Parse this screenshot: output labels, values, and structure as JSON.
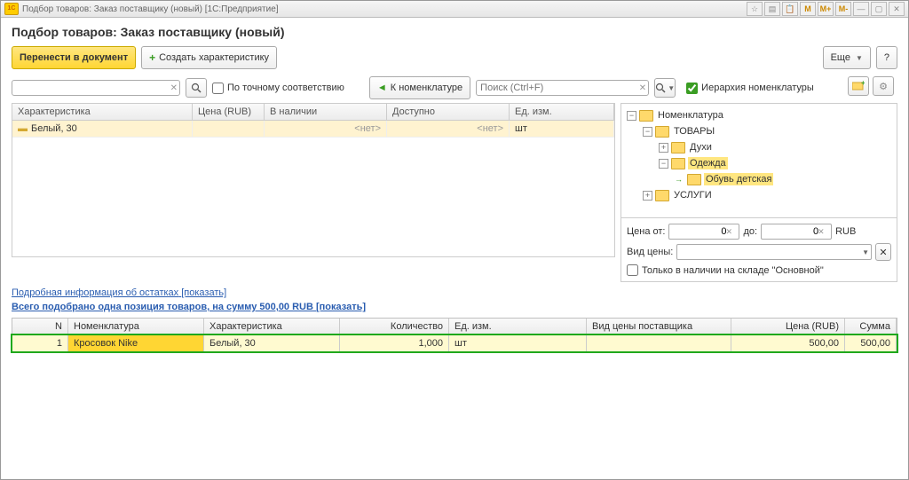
{
  "titlebar": {
    "text": "Подбор товаров: Заказ поставщику (новый)  [1С:Предприятие]",
    "buttons": {
      "m": "M",
      "mplus": "M+",
      "mminus": "M-"
    }
  },
  "header": {
    "title": "Подбор товаров: Заказ поставщику (новый)"
  },
  "toolbar": {
    "transfer": "Перенести в документ",
    "create_char": "Создать характеристику",
    "more": "Еще",
    "help": "?"
  },
  "filter": {
    "exact_match": "По точному соответствию",
    "to_nomenclature": "К номенклатуре",
    "search_placeholder": "Поиск (Ctrl+F)",
    "hierarchy": "Иерархия номенклатуры"
  },
  "chars_table": {
    "headers": {
      "char": "Характеристика",
      "price": "Цена (RUB)",
      "stock": "В наличии",
      "avail": "Доступно",
      "uom": "Ед. изм."
    },
    "rows": [
      {
        "char": "Белый, 30",
        "price": "",
        "stock": "<нет>",
        "avail": "<нет>",
        "uom": "шт"
      }
    ]
  },
  "tree": {
    "root": "Номенклатура",
    "lvl1": "ТОВАРЫ",
    "lvl2a": "Духи",
    "lvl2b": "Одежда",
    "lvl3": "Обувь детская",
    "lvl1b": "УСЛУГИ"
  },
  "price_filter": {
    "from": "Цена от:",
    "to": "до:",
    "currency": "RUB",
    "from_val": "0",
    "to_val": "0",
    "price_type": "Вид цены:",
    "only_stock": "Только в наличии на складе \"Основной\""
  },
  "links": {
    "details": "Подробная информация об остатках",
    "show": "[показать]",
    "summary_prefix": "Всего подобрано одна позиция товаров, на сумму 500,00 RUB",
    "summary_link": "[показать]"
  },
  "bottom_table": {
    "headers": {
      "n": "N",
      "nom": "Номенклатура",
      "char": "Характеристика",
      "qty": "Количество",
      "uom": "Ед. изм.",
      "ptype": "Вид цены поставщика",
      "price": "Цена (RUB)",
      "sum": "Сумма"
    },
    "rows": [
      {
        "n": "1",
        "nom": "Кросовок Nike",
        "char": "Белый, 30",
        "qty": "1,000",
        "uom": "шт",
        "ptype": "",
        "price": "500,00",
        "sum": "500,00"
      }
    ]
  }
}
